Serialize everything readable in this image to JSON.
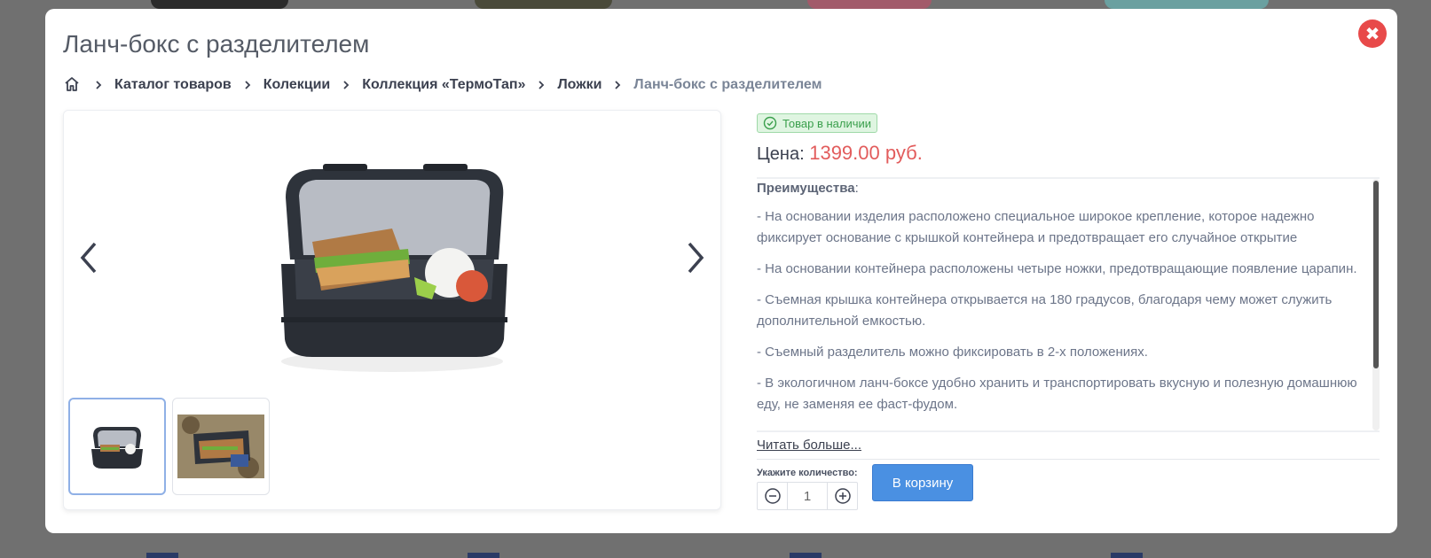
{
  "modal": {
    "title": "Ланч-бокс с разделителем",
    "close_icon": "close-icon"
  },
  "breadcrumb": {
    "home_icon": "home-icon",
    "items": [
      "Каталог товаров",
      "Колекции",
      "Коллекция «ТермоТап»",
      "Ложки"
    ],
    "current": "Ланч-бокс с разделителем"
  },
  "product": {
    "stock_status": "Товар в наличии",
    "price_label": "Цена:",
    "price": "1399.00 руб.",
    "advantages_title": "Преимущества",
    "advantages_colon": ":",
    "advantages": [
      "- На основании изделия расположено специальное широкое крепление, которое надежно фиксирует основание с крышкой контейнера и предотвращает его случайное открытие",
      "- На основании контейнера расположены четыре ножки, предотвращающие появление царапин.",
      "- Съемная крышка контейнера открывается на 180 градусов, благодаря чему может служить дополнительной емкостью.",
      "- Съемный разделитель можно фиксировать в 2-х положениях.",
      "- В экологичном ланч-боксе удобно хранить и транспортировать вкусную и полезную домашнюю еду, не заменяя ее фаст-фудом."
    ],
    "read_more": "Читать больше...",
    "quantity_label": "Укажите количество:",
    "quantity_value": "1",
    "add_to_cart": "В корзину"
  },
  "colors": {
    "accent": "#4a90e2",
    "price": "#e25c5c",
    "close": "#e84a4a",
    "stock": "#3a9f4c"
  }
}
